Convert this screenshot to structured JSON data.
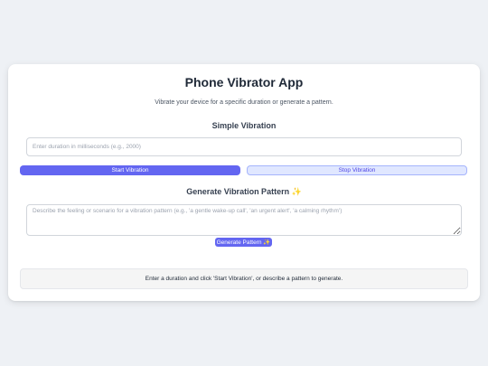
{
  "app": {
    "title": "Phone Vibrator App",
    "subtitle": "Vibrate your device for a specific duration or generate a pattern."
  },
  "simple": {
    "heading": "Simple Vibration",
    "duration_placeholder": "Enter duration in milliseconds (e.g., 2000)",
    "duration_value": "",
    "start_label": "Start Vibration",
    "stop_label": "Stop Vibration"
  },
  "pattern": {
    "heading": "Generate Vibration Pattern ✨",
    "description_placeholder": "Describe the feeling or scenario for a vibration pattern (e.g., 'a gentle wake-up call', 'an urgent alert', 'a calming rhythm')",
    "description_value": "",
    "generate_label": "Generate Pattern ✨"
  },
  "status": {
    "message": "Enter a duration and click 'Start Vibration', or describe a pattern to generate."
  },
  "colors": {
    "accent": "#6366f1",
    "stop_bg": "#e0e7ff",
    "background": "#eef1f5"
  }
}
